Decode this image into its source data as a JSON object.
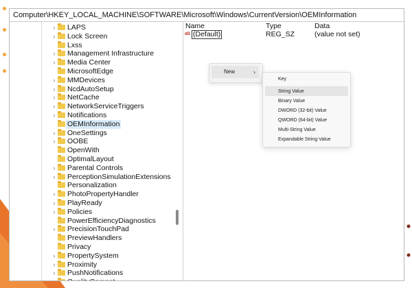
{
  "window": {
    "address_path": "Computer\\HKEY_LOCAL_MACHINE\\SOFTWARE\\Microsoft\\Windows\\CurrentVersion\\OEMInformation"
  },
  "tree": {
    "items": [
      {
        "label": "LAPS",
        "expandable": true
      },
      {
        "label": "Lock Screen",
        "expandable": true
      },
      {
        "label": "Lxss",
        "expandable": false
      },
      {
        "label": "Management Infrastructure",
        "expandable": true
      },
      {
        "label": "Media Center",
        "expandable": true
      },
      {
        "label": "MicrosoftEdge",
        "expandable": false
      },
      {
        "label": "MMDevices",
        "expandable": true
      },
      {
        "label": "NcdAutoSetup",
        "expandable": true
      },
      {
        "label": "NetCache",
        "expandable": true
      },
      {
        "label": "NetworkServiceTriggers",
        "expandable": true
      },
      {
        "label": "Notifications",
        "expandable": true
      },
      {
        "label": "OEMInformation",
        "expandable": false,
        "selected": true
      },
      {
        "label": "OneSettings",
        "expandable": true
      },
      {
        "label": "OOBE",
        "expandable": true
      },
      {
        "label": "OpenWith",
        "expandable": false
      },
      {
        "label": "OptimalLayout",
        "expandable": false
      },
      {
        "label": "Parental Controls",
        "expandable": true
      },
      {
        "label": "PerceptionSimulationExtensions",
        "expandable": true
      },
      {
        "label": "Personalization",
        "expandable": false
      },
      {
        "label": "PhotoPropertyHandler",
        "expandable": true
      },
      {
        "label": "PlayReady",
        "expandable": true
      },
      {
        "label": "Policies",
        "expandable": true
      },
      {
        "label": "PowerEfficiencyDiagnostics",
        "expandable": false
      },
      {
        "label": "PrecisionTouchPad",
        "expandable": true
      },
      {
        "label": "PreviewHandlers",
        "expandable": false
      },
      {
        "label": "Privacy",
        "expandable": false
      },
      {
        "label": "PropertySystem",
        "expandable": true
      },
      {
        "label": "Proximity",
        "expandable": true
      },
      {
        "label": "PushNotifications",
        "expandable": true
      },
      {
        "label": "QualityCompat",
        "expandable": true
      }
    ]
  },
  "values_pane": {
    "columns": {
      "name": "Name",
      "type": "Type",
      "data": "Data"
    },
    "rows": [
      {
        "icon": "string-value-icon",
        "icon_text": "ab",
        "name": "(Default)",
        "type": "REG_SZ",
        "data": "(value not set)"
      }
    ]
  },
  "context_menu": {
    "new_label": "New",
    "submenu": [
      "Key",
      "String Value",
      "Binary Value",
      "DWORD (32-bit) Value",
      "QWORD (64-bit) Value",
      "Multi-String Value",
      "Expandable String Value"
    ],
    "hovered_item": "String Value"
  },
  "colors": {
    "accent_orange": "#e8742a",
    "selection": "#d9ebf9",
    "folder": "#f2c94c"
  }
}
